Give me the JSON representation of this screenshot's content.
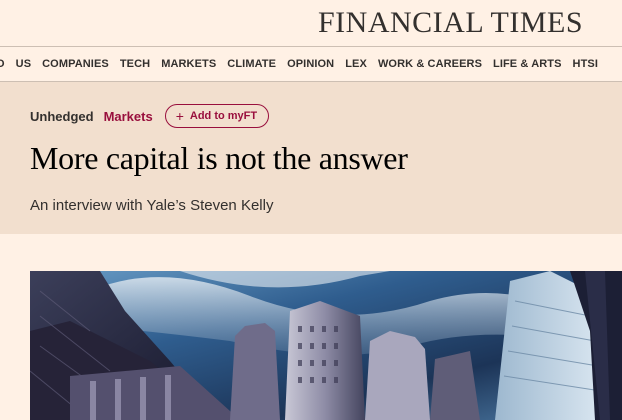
{
  "masthead": {
    "title": "FINANCIAL TIMES"
  },
  "nav": {
    "items": [
      "O",
      "US",
      "COMPANIES",
      "TECH",
      "MARKETS",
      "CLIMATE",
      "OPINION",
      "LEX",
      "WORK & CAREERS",
      "LIFE & ARTS",
      "HTSI"
    ]
  },
  "article": {
    "topics": {
      "primary": "Unhedged",
      "secondary": "Markets"
    },
    "myft_label": "Add to myFT",
    "headline": "More capital is not the answer",
    "standfirst": "An interview with Yale’s Steven Kelly"
  },
  "colors": {
    "page_background": "#fff1e5",
    "header_background": "#f2dfce",
    "accent": "#990f3d",
    "text": "#33302e"
  },
  "icons": {
    "myft": "plus-icon"
  }
}
